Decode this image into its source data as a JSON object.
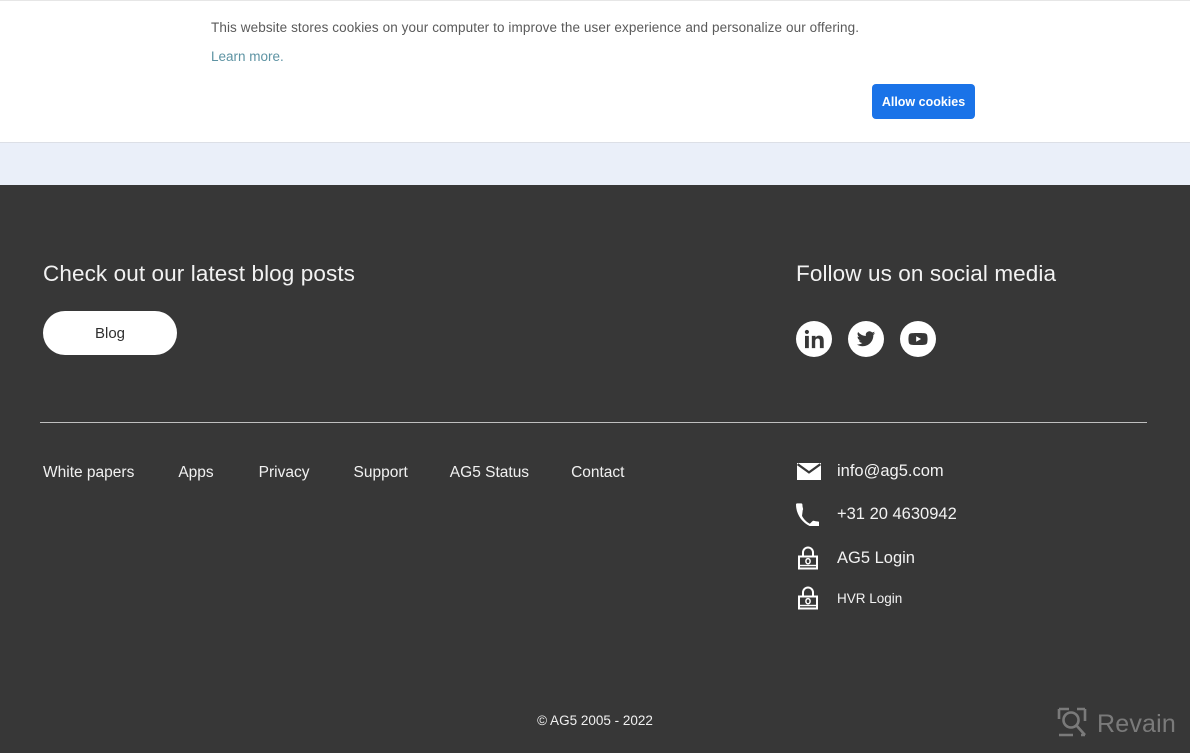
{
  "cookie_banner": {
    "message": "This website stores cookies on your computer to improve the user experience and personalize our offering.",
    "learn_more_label": "Learn more.",
    "allow_button_label": "Allow cookies",
    "accent_color": "#1a73e8",
    "link_color": "#5d93a3"
  },
  "footer": {
    "background_color": "#373737",
    "blog": {
      "heading": "Check out our latest blog posts",
      "button_label": "Blog"
    },
    "social": {
      "heading": "Follow us on social media",
      "icons": [
        {
          "name": "linkedin-icon",
          "label": "LinkedIn"
        },
        {
          "name": "twitter-icon",
          "label": "Twitter"
        },
        {
          "name": "youtube-icon",
          "label": "YouTube"
        }
      ]
    },
    "nav_links": [
      {
        "label": "White papers"
      },
      {
        "label": "Apps"
      },
      {
        "label": "Privacy"
      },
      {
        "label": "Support"
      },
      {
        "label": "AG5 Status"
      },
      {
        "label": "Contact"
      }
    ],
    "contact": [
      {
        "icon": "envelope-icon",
        "label": "info@ag5.com"
      },
      {
        "icon": "phone-icon",
        "label": "+31 20 4630942"
      },
      {
        "icon": "lock-icon",
        "label": "AG5 Login"
      },
      {
        "icon": "lock-icon",
        "label": "HVR Login"
      }
    ],
    "copyright": "© AG5 2005 - 2022"
  },
  "watermark": {
    "text": "Revain"
  }
}
